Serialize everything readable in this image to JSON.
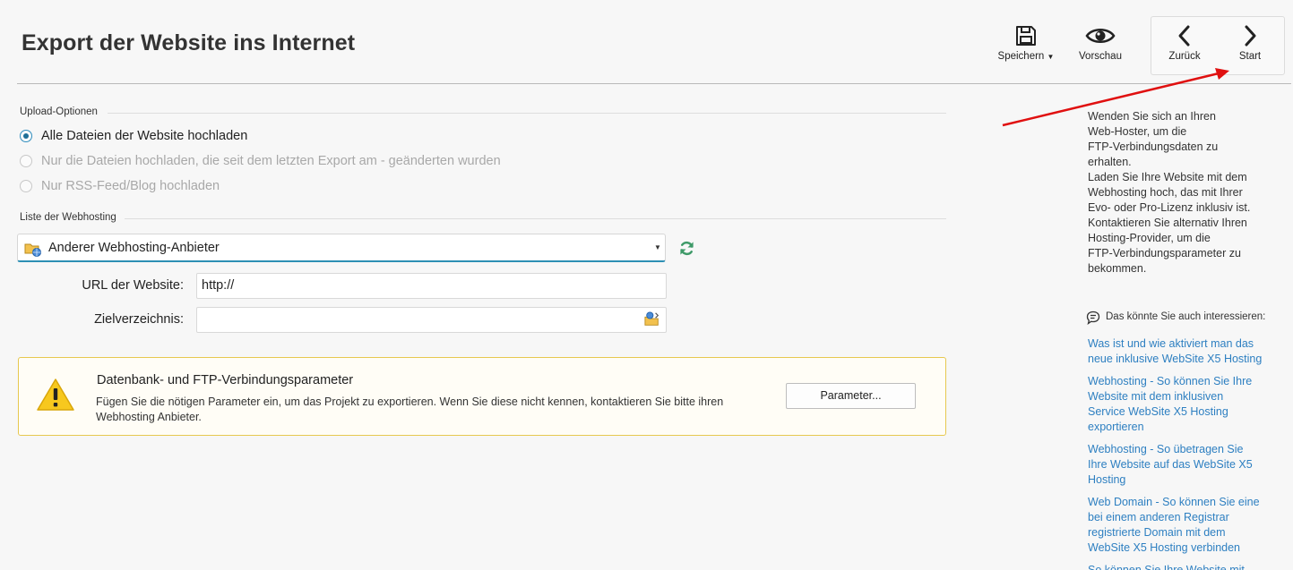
{
  "page": {
    "title": "Export der Website ins Internet"
  },
  "toolbar": {
    "save_label": "Speichern",
    "preview_label": "Vorschau",
    "back_label": "Zurück",
    "start_label": "Start"
  },
  "upload_options": {
    "section_label": "Upload-Optionen",
    "options": [
      {
        "label": "Alle Dateien der Website hochladen",
        "selected": true,
        "enabled": true
      },
      {
        "label": "Nur die Dateien hochladen, die seit dem letzten Export am - geänderten wurden",
        "selected": false,
        "enabled": false
      },
      {
        "label": "Nur RSS-Feed/Blog hochladen",
        "selected": false,
        "enabled": false
      }
    ]
  },
  "webhosting": {
    "section_label": "Liste der Webhosting",
    "selected_value": "Anderer Webhosting-Anbieter",
    "url_label": "URL der Website:",
    "url_value": "http://",
    "dir_label": "Zielverzeichnis:",
    "dir_value": ""
  },
  "warning": {
    "title": "Datenbank- und FTP-Verbindungsparameter",
    "text": "Fügen Sie die nötigen Parameter ein, um das Projekt zu exportieren. Wenn Sie diese nicht kennen, kontaktieren Sie bitte ihren Webhosting Anbieter.",
    "button_label": "Parameter..."
  },
  "sidebar": {
    "help_lines": [
      "Wenden Sie sich an Ihren",
      "Web-Hoster, um die",
      "FTP-Verbindungsdaten zu",
      "erhalten.",
      "Laden Sie Ihre Website mit dem",
      "Webhosting hoch, das mit Ihrer",
      "Evo- oder Pro-Lizenz inklusiv ist.",
      "Kontaktieren Sie  alternativ Ihren",
      "Hosting-Provider, um die",
      "FTP-Verbindungsparameter zu",
      "bekommen."
    ],
    "interest_title": "Das könnte Sie auch interessieren:",
    "links": [
      {
        "lines": [
          "Was ist und wie aktiviert man das",
          "neue inklusive WebSite X5 Hosting"
        ]
      },
      {
        "lines": [
          "Webhosting - So können Sie Ihre",
          "Website mit dem inklusiven",
          "Service WebSite X5 Hosting",
          "exportieren"
        ]
      },
      {
        "lines": [
          "Webhosting - So übetragen Sie",
          "Ihre Website auf das WebSite X5",
          "Hosting"
        ]
      },
      {
        "lines": [
          "Web Domain - So können Sie eine",
          "bei einem anderen Registrar",
          "registrierte Domain mit dem",
          "WebSite X5 Hosting verbinden"
        ]
      },
      {
        "lines": [
          "So können Sie Ihre Website mit"
        ]
      }
    ]
  },
  "colors": {
    "accent": "#2d8fb4",
    "link": "#2d7fc1",
    "warning_border": "#e7c84f",
    "annotation_arrow": "#e01010"
  }
}
